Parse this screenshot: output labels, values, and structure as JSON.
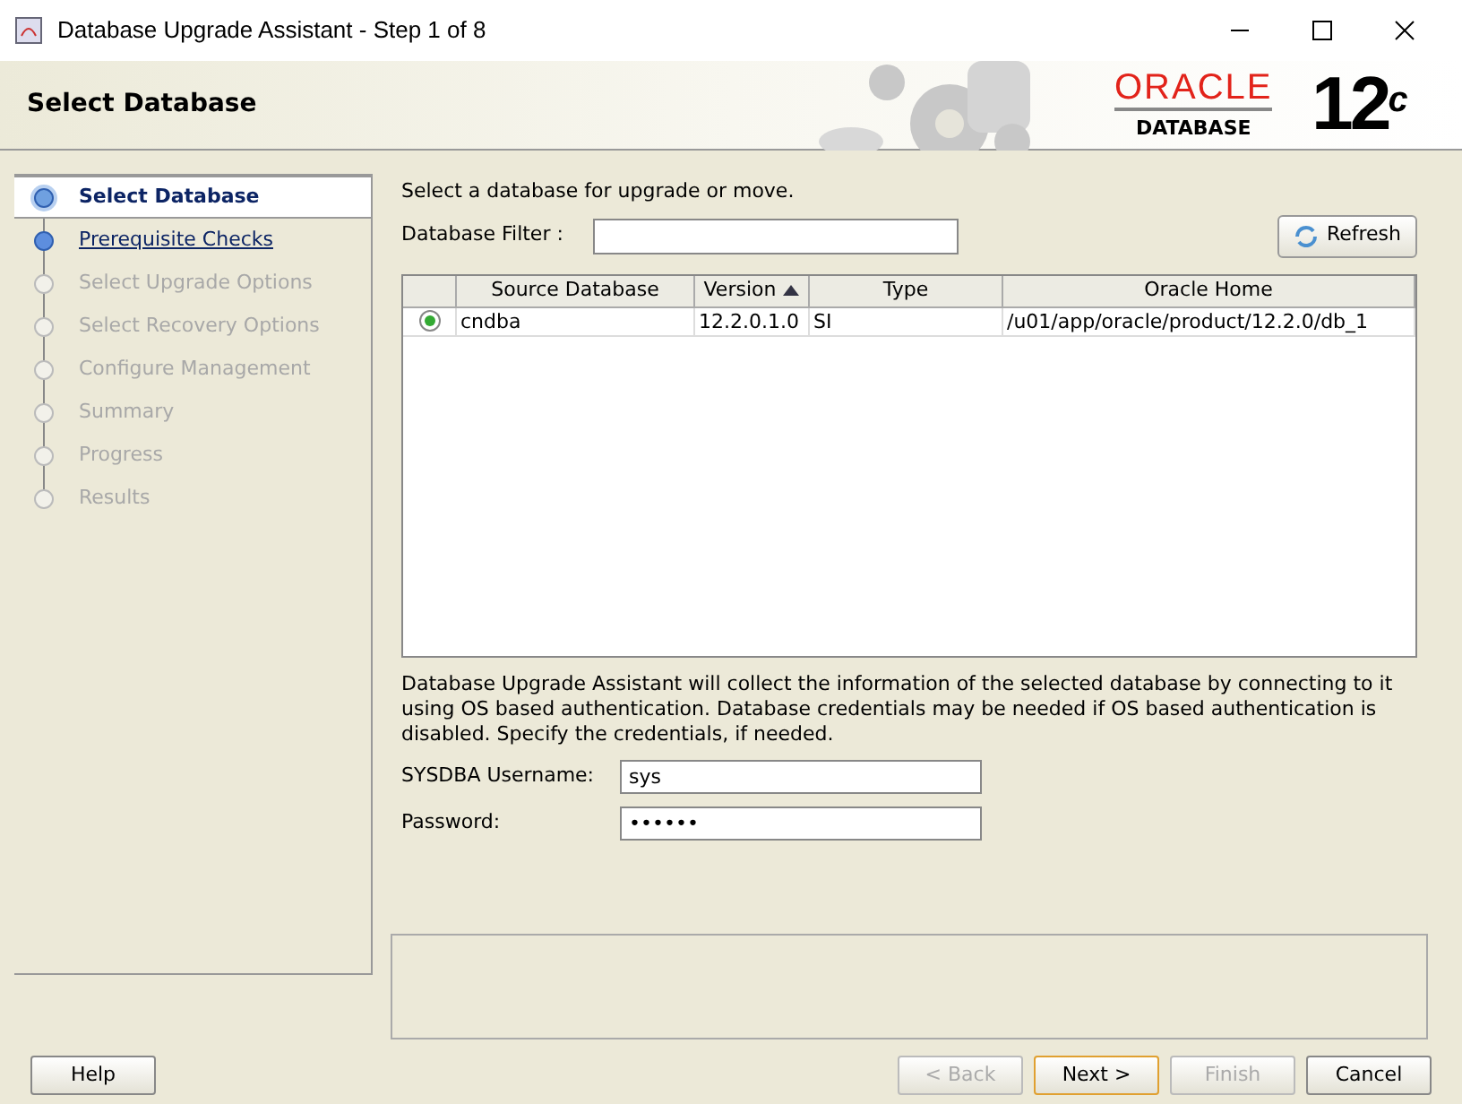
{
  "window": {
    "title": "Database Upgrade Assistant - Step 1 of 8"
  },
  "header": {
    "title": "Select Database",
    "logo": {
      "brand": "ORACLE",
      "product": "DATABASE",
      "version": "12",
      "version_suffix": "c"
    }
  },
  "steps": [
    {
      "label": "Select Database",
      "selected": true,
      "enabled": true
    },
    {
      "label": "Prerequisite Checks",
      "selected": false,
      "enabled": true
    },
    {
      "label": "Select Upgrade Options",
      "selected": false,
      "enabled": false
    },
    {
      "label": "Select Recovery Options",
      "selected": false,
      "enabled": false
    },
    {
      "label": "Configure Management",
      "selected": false,
      "enabled": false
    },
    {
      "label": "Summary",
      "selected": false,
      "enabled": false
    },
    {
      "label": "Progress",
      "selected": false,
      "enabled": false
    },
    {
      "label": "Results",
      "selected": false,
      "enabled": false
    }
  ],
  "instruction": "Select a database for upgrade or move.",
  "filter": {
    "label": "Database Filter :"
  },
  "refresh_button": "Refresh",
  "table": {
    "columns": [
      {
        "label": "Source Database",
        "sorted": false
      },
      {
        "label": "Version",
        "sorted": true
      },
      {
        "label": "Type",
        "sorted": false
      },
      {
        "label": "Oracle Home",
        "sorted": false
      }
    ],
    "rows": [
      {
        "selected": true,
        "cells": [
          "cndba",
          "12.2.0.1.0",
          "SI",
          "/u01/app/oracle/product/12.2.0/db_1"
        ]
      }
    ]
  },
  "note": "Database Upgrade Assistant will collect the information of the selected database by connecting to it using OS based authentication. Database credentials may be needed if OS based authentication is disabled. Specify the credentials, if needed.",
  "fields": [
    {
      "label": "SYSDBA Username:",
      "value": "sys"
    },
    {
      "label": "Password:",
      "value": "••••••"
    }
  ],
  "buttons": [
    {
      "label": "Help",
      "disabled": false,
      "default": false
    },
    {
      "label": "< Back",
      "disabled": true,
      "default": false
    },
    {
      "label": "Next >",
      "disabled": false,
      "default": true
    },
    {
      "label": "Finish",
      "disabled": true,
      "default": false
    },
    {
      "label": "Cancel",
      "disabled": false,
      "default": false
    }
  ]
}
